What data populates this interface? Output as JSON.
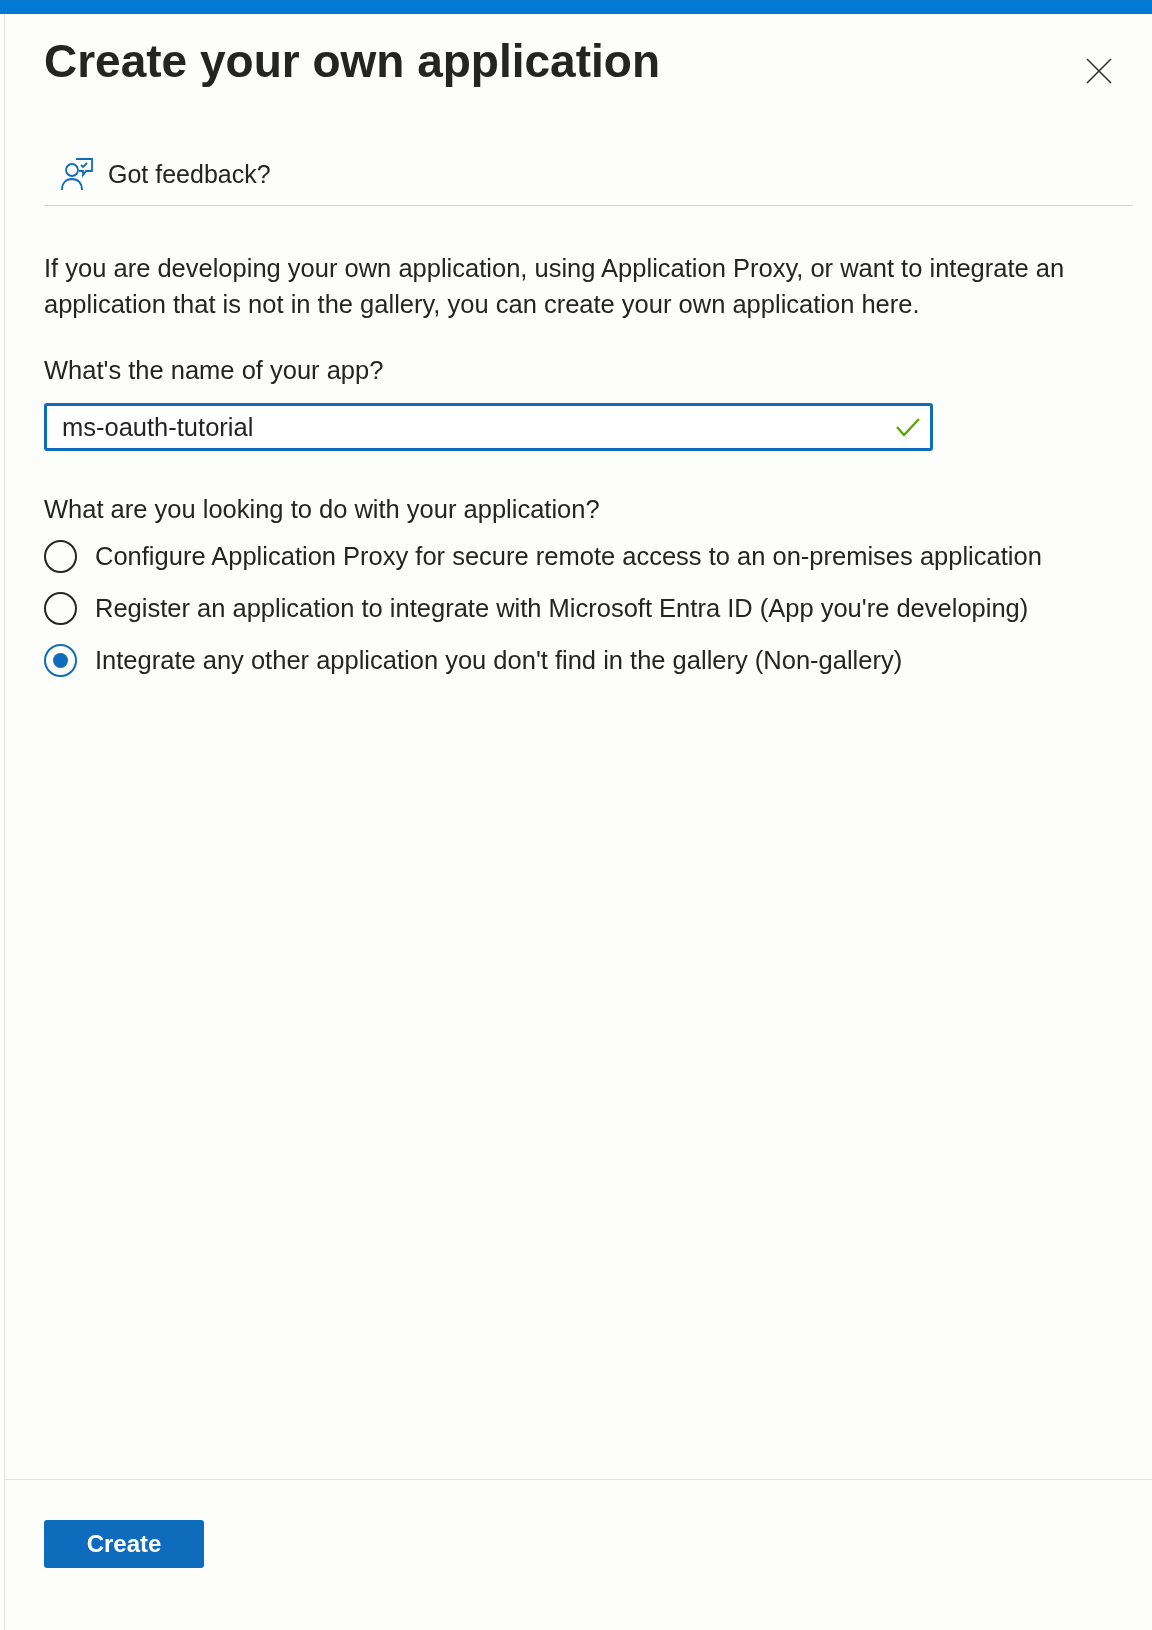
{
  "panel": {
    "title": "Create your own application"
  },
  "feedback": {
    "label": "Got feedback?"
  },
  "description": "If you are developing your own application, using Application Proxy, or want to integrate an application that is not in the gallery, you can create your own application here.",
  "name_field": {
    "label": "What's the name of your app?",
    "value": "ms-oauth-tutorial",
    "valid": true
  },
  "purpose": {
    "question": "What are you looking to do with your application?",
    "options": [
      {
        "label": "Configure Application Proxy for secure remote access to an on-premises application",
        "selected": false
      },
      {
        "label": "Register an application to integrate with Microsoft Entra ID (App you're developing)",
        "selected": false
      },
      {
        "label": "Integrate any other application you don't find in the gallery (Non-gallery)",
        "selected": true
      }
    ]
  },
  "buttons": [
    {
      "label": "Create",
      "kind": "primary"
    }
  ]
}
